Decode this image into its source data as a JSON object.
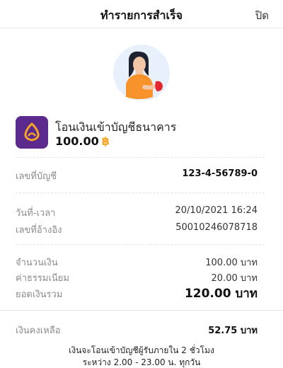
{
  "header": {
    "title": "ทำรายการสำเร็จ",
    "close_label": "ปิด"
  },
  "transaction": {
    "title": "โอนเงินเข้าบัญชีธนาคาร",
    "amount": "100.00",
    "currency_symbol": "฿"
  },
  "details": {
    "account_label": "เลขที่บัญชี",
    "account_value": "123-4-56789-0",
    "datetime_label": "วันที่-เวลา",
    "datetime_value": "20/10/2021 16:24",
    "reference_label": "เลขที่อ้างอิง",
    "reference_value": "50010246078718",
    "amount_label": "จำนวนเงิน",
    "amount_value": "100.00 บาท",
    "fee_label": "ค่าธรรมเนียม",
    "fee_value": "20.00 บาท",
    "total_label": "ยอดเงินรวม",
    "total_value": "120.00 บาท",
    "balance_label": "เงินคงเหลือ",
    "balance_value": "52.75 บาท"
  },
  "note": {
    "line1": "เงินจะโอนเข้าบัญชีผู้รับภายใน 2 ชั่วโมง",
    "line2": "ระหว่าง 2.00 - 23.00 น. ทุกวัน"
  },
  "colors": {
    "brand_purple": "#5b2a8c",
    "accent_gold": "#f5a623",
    "illustration_bg": "#e8f1fb"
  },
  "icons": {
    "bank_logo": "scb-bank-icon",
    "illustration": "success-person-illustration"
  }
}
